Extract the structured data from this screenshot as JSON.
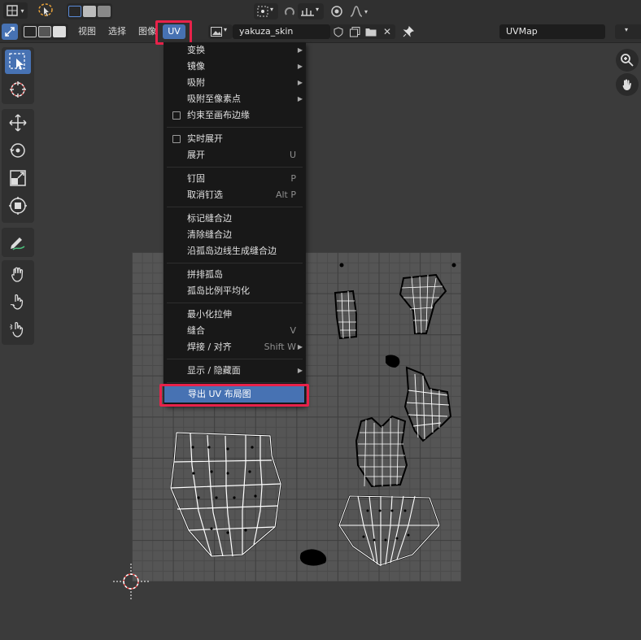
{
  "header": {
    "menus": [
      "视图",
      "选择",
      "图像"
    ],
    "uv_menu_label": "UV",
    "image_name": "yakuza_skin",
    "uvmap_name": "UVMap"
  },
  "uv_menu": {
    "groups": [
      [
        {
          "label": "变换",
          "shortcut": "",
          "submenu": true,
          "checkbox": false
        },
        {
          "label": "镜像",
          "shortcut": "",
          "submenu": true,
          "checkbox": false
        },
        {
          "label": "吸附",
          "shortcut": "",
          "submenu": true,
          "checkbox": false
        },
        {
          "label": "吸附至像素点",
          "shortcut": "",
          "submenu": true,
          "checkbox": false
        },
        {
          "label": "约束至画布边缘",
          "shortcut": "",
          "submenu": false,
          "checkbox": true
        }
      ],
      [
        {
          "label": "实时展开",
          "shortcut": "",
          "submenu": false,
          "checkbox": true
        },
        {
          "label": "展开",
          "shortcut": "U",
          "submenu": false,
          "checkbox": false
        }
      ],
      [
        {
          "label": "钉固",
          "shortcut": "P",
          "submenu": false,
          "checkbox": false
        },
        {
          "label": "取消钉选",
          "shortcut": "Alt P",
          "submenu": false,
          "checkbox": false
        }
      ],
      [
        {
          "label": "标记缝合边",
          "shortcut": "",
          "submenu": false,
          "checkbox": false
        },
        {
          "label": "清除缝合边",
          "shortcut": "",
          "submenu": false,
          "checkbox": false
        },
        {
          "label": "沿孤岛边线生成缝合边",
          "shortcut": "",
          "submenu": false,
          "checkbox": false
        }
      ],
      [
        {
          "label": "拼排孤岛",
          "shortcut": "",
          "submenu": false,
          "checkbox": false
        },
        {
          "label": "孤岛比例平均化",
          "shortcut": "",
          "submenu": false,
          "checkbox": false
        }
      ],
      [
        {
          "label": "最小化拉伸",
          "shortcut": "",
          "submenu": false,
          "checkbox": false
        },
        {
          "label": "缝合",
          "shortcut": "V",
          "submenu": false,
          "checkbox": false
        },
        {
          "label": "焊接 / 对齐",
          "shortcut": "Shift W",
          "submenu": true,
          "checkbox": false
        }
      ],
      [
        {
          "label": "显示 / 隐藏面",
          "shortcut": "",
          "submenu": true,
          "checkbox": false
        }
      ],
      [
        {
          "label": "导出 UV 布局图",
          "shortcut": "",
          "submenu": false,
          "checkbox": false,
          "highlighted": true
        }
      ]
    ]
  },
  "icons": {
    "editor_type": "uv-editor-icon",
    "tools": [
      "select-box-icon",
      "cursor-icon",
      "move-icon",
      "rotate-icon",
      "scale-icon",
      "transform-icon",
      "annotate-icon",
      "grab-icon",
      "relax-icon",
      "pinch-icon"
    ],
    "nav": [
      "zoom-icon",
      "pan-hand-icon"
    ]
  },
  "colors": {
    "accent": "#4772b3",
    "highlight_box": "#e8224a",
    "header_bg": "#303030",
    "viewport_bg": "#3b3b3b"
  }
}
